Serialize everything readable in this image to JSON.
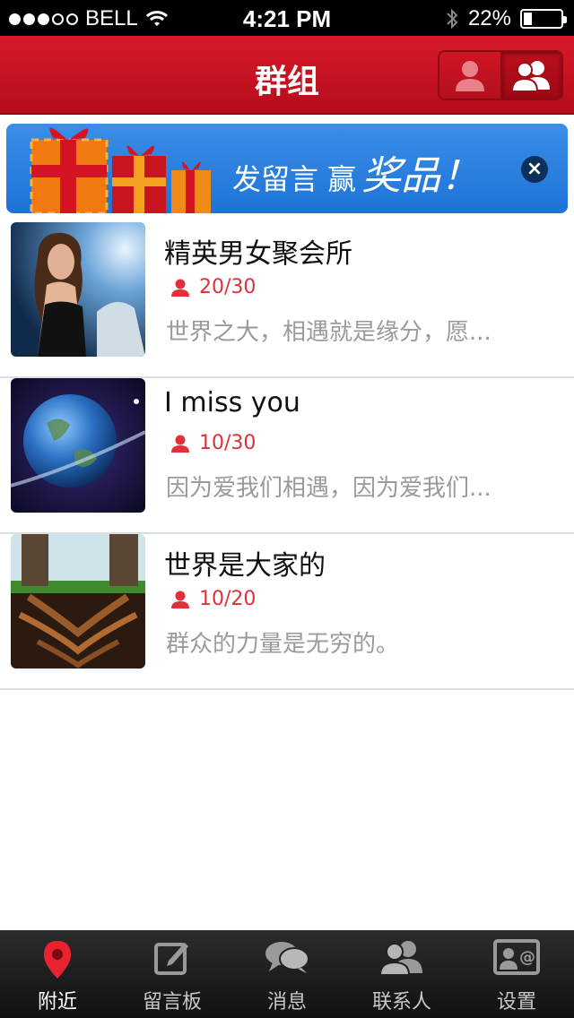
{
  "status_bar": {
    "carrier": "BELL",
    "time": "4:21 PM",
    "battery": "22%",
    "signal_strength": 3,
    "signal_max": 5,
    "battery_level": 0.22
  },
  "nav": {
    "title": "群组"
  },
  "banner": {
    "text": "发留言 赢",
    "highlight": "奖品！",
    "close_symbol": "×"
  },
  "groups": [
    {
      "name": "精英男女聚会所",
      "members": "20/30",
      "description": "世界之大，相遇就是缘分，愿..."
    },
    {
      "name": "I miss you",
      "members": "10/30",
      "description": "因为爱我们相遇，因为爱我们..."
    },
    {
      "name": "世界是大家的",
      "members": "10/20",
      "description": "群众的力量是无穷的。"
    }
  ],
  "tabs": [
    {
      "label": "附近",
      "icon": "location-pin-icon",
      "active": true
    },
    {
      "label": "留言板",
      "icon": "compose-icon",
      "active": false
    },
    {
      "label": "消息",
      "icon": "chat-bubbles-icon",
      "active": false
    },
    {
      "label": "联系人",
      "icon": "contacts-icon",
      "active": false
    },
    {
      "label": "设置",
      "icon": "settings-card-icon",
      "active": false
    }
  ],
  "colors": {
    "brand_red": "#c8101f",
    "banner_blue": "#2b82e3",
    "member_red": "#e0303a",
    "tab_active": "#e8232f"
  }
}
